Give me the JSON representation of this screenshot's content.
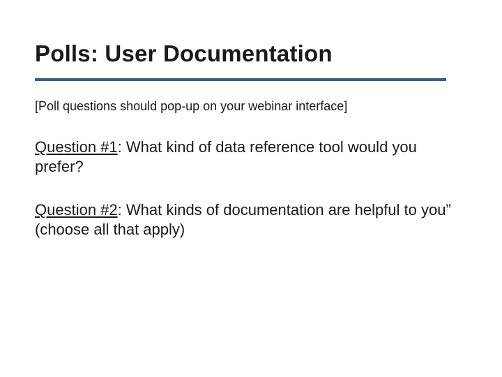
{
  "title": "Polls:  User Documentation",
  "note": "[Poll questions should pop-up on your webinar interface]",
  "questions": [
    {
      "label": "Question #1",
      "text": ": What kind of data reference tool would you prefer?"
    },
    {
      "label": "Question #2",
      "text": ": What kinds of documentation are helpful to you” (choose all that apply)"
    }
  ],
  "colors": {
    "rule": "#3b5f84"
  }
}
